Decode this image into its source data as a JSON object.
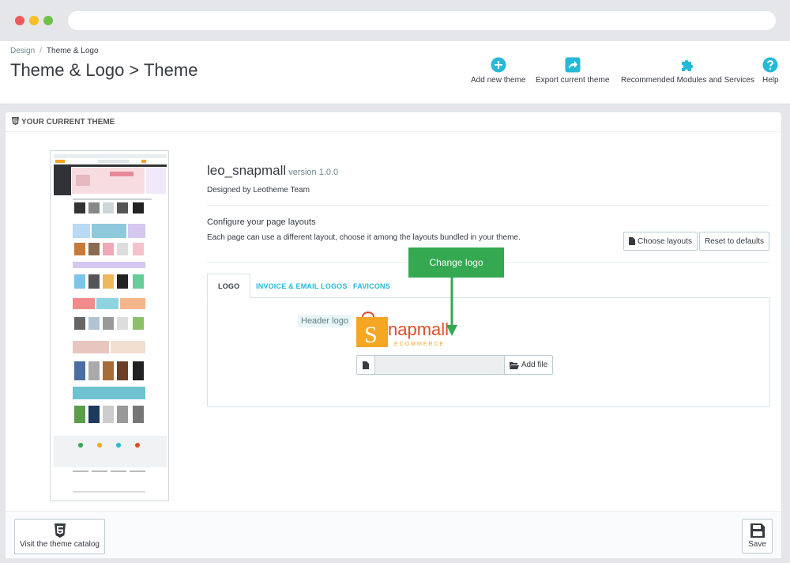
{
  "colors": {
    "accent": "#25b9d7",
    "annotation": "#35a852",
    "logo_orange": "#f5a623",
    "logo_red": "#e04d2b"
  },
  "breadcrumb": {
    "parent": "Design",
    "current": "Theme & Logo"
  },
  "page_title": "Theme & Logo > Theme",
  "toolbar": [
    {
      "label": "Add new theme",
      "icon": "plus-circle-icon"
    },
    {
      "label": "Export current theme",
      "icon": "share-icon"
    },
    {
      "label": "Recommended Modules and Services",
      "icon": "puzzle-icon"
    },
    {
      "label": "Help",
      "icon": "question-circle-icon"
    }
  ],
  "panel": {
    "heading": "YOUR CURRENT THEME",
    "theme_name": "leo_snapmall",
    "theme_version": "version 1.0.0",
    "author": "Designed by Leotheme Team",
    "layouts_title": "Configure your page layouts",
    "layouts_desc": "Each page can use a different layout, choose it among the layouts bundled in your theme.",
    "choose_layouts": "Choose layouts",
    "reset_defaults": "Reset to defaults"
  },
  "tabs": [
    {
      "label": "LOGO",
      "active": true
    },
    {
      "label": "INVOICE & EMAIL LOGOS",
      "active": false
    },
    {
      "label": "FAVICONS",
      "active": false
    }
  ],
  "logo_tab": {
    "header_logo_label": "Header logo",
    "add_file": "Add file",
    "logo_brand": "napmall",
    "logo_letter": "S",
    "logo_sub": "ECOMMERCE"
  },
  "annotation": {
    "text": "Change logo"
  },
  "footer": {
    "catalog": "Visit the theme catalog",
    "save": "Save"
  }
}
